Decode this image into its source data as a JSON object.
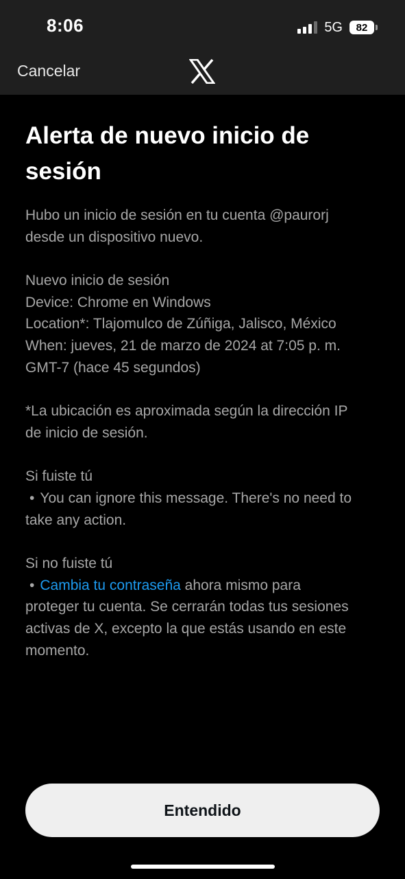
{
  "status_bar": {
    "time": "8:06",
    "network": "5G",
    "battery": "82"
  },
  "nav": {
    "cancel_label": "Cancelar",
    "logo_icon": "x-logo-icon"
  },
  "alert": {
    "title_line1": "Alerta de nuevo inicio de",
    "title_line2": "sesión",
    "intro_line1": "Hubo un inicio de sesión en tu cuenta @paurorj",
    "intro_line2": "desde un dispositivo nuevo.",
    "details": {
      "heading": "Nuevo inicio de sesión",
      "device": "Device: Chrome en Windows",
      "location": "Location*: Tlajomulco de Zúñiga, Jalisco, México",
      "when_line1": "When: jueves, 21 de marzo de 2024 at 7:05 p. m.",
      "when_line2": "GMT-7 (hace 45 segundos)"
    },
    "note_line1": "*La ubicación es aproximada según la dirección IP",
    "note_line2": "de inicio de sesión.",
    "if_you": {
      "heading": "Si fuiste tú",
      "bullet": "•",
      "text_line1": "You can ignore this message. There's no need to",
      "text_line2": "take any action."
    },
    "if_not_you": {
      "heading": "Si no fuiste tú",
      "bullet": "•",
      "link": "Cambia tu contraseña",
      "text_after_link": " ahora mismo para",
      "text_line2": "proteger tu cuenta. Se cerrarán todas tus sesiones",
      "text_line3": "activas de X, excepto la que estás usando en este",
      "text_line4": "momento."
    }
  },
  "actions": {
    "ok_label": "Entendido"
  },
  "colors": {
    "background": "#000000",
    "header": "#1f1f1f",
    "link": "#1d9bf0",
    "body_text": "#a7a7a7",
    "button": "#efefef"
  }
}
